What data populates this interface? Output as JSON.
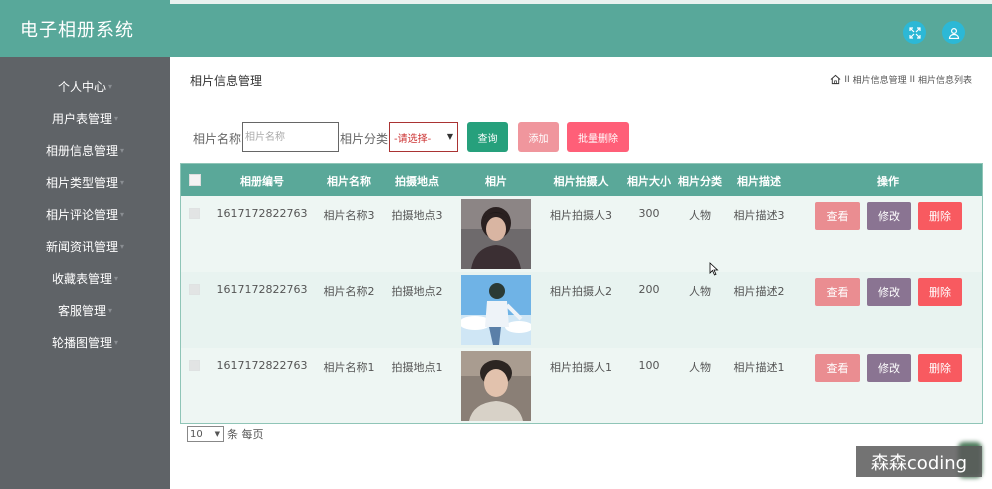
{
  "app": {
    "title": "电子相册系统"
  },
  "header": {
    "btn1_icon": "fullscreen-icon",
    "btn2_icon": "user-icon"
  },
  "sidebar": {
    "items": [
      {
        "label": "个人中心"
      },
      {
        "label": "用户表管理"
      },
      {
        "label": "相册信息管理"
      },
      {
        "label": "相片类型管理"
      },
      {
        "label": "相片评论管理"
      },
      {
        "label": "新闻资讯管理"
      },
      {
        "label": "收藏表管理"
      },
      {
        "label": "客服管理"
      },
      {
        "label": "轮播图管理"
      }
    ]
  },
  "page": {
    "title": "相片信息管理",
    "breadcrumb": [
      "相片信息管理",
      "相片信息列表"
    ],
    "breadcrumb_sep": "II"
  },
  "search": {
    "name_label": "相片名称",
    "name_placeholder": "相片名称",
    "category_label": "相片分类",
    "category_selected": "-请选择-",
    "query_label": "查询",
    "add_label": "添加",
    "batch_delete_label": "批量删除"
  },
  "table": {
    "columns": [
      "相册编号",
      "相片名称",
      "拍摄地点",
      "相片",
      "相片拍摄人",
      "相片大小",
      "相片分类",
      "相片描述",
      "操作"
    ],
    "rows": [
      {
        "id": "1617172822763",
        "name": "相片名称3",
        "location": "拍摄地点3",
        "photographer": "相片拍摄人3",
        "size": "300",
        "category": "人物",
        "desc": "相片描述3"
      },
      {
        "id": "1617172822763",
        "name": "相片名称2",
        "location": "拍摄地点2",
        "photographer": "相片拍摄人2",
        "size": "200",
        "category": "人物",
        "desc": "相片描述2"
      },
      {
        "id": "1617172822763",
        "name": "相片名称1",
        "location": "拍摄地点1",
        "photographer": "相片拍摄人1",
        "size": "100",
        "category": "人物",
        "desc": "相片描述1"
      }
    ],
    "actions": {
      "view": "查看",
      "edit": "修改",
      "delete": "删除"
    }
  },
  "pager": {
    "page_size": "10",
    "suffix": "条 每页"
  },
  "watermark": "森森coding"
}
